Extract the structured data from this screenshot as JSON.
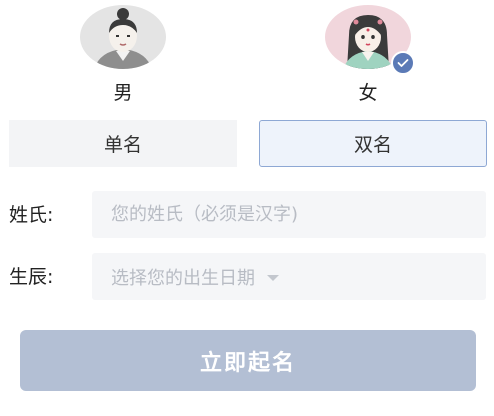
{
  "gender": {
    "male": {
      "label": "男",
      "icon": "male-avatar-icon"
    },
    "female": {
      "label": "女",
      "icon": "female-avatar-icon",
      "selected": true
    }
  },
  "name_type": {
    "single": "单名",
    "double": "双名",
    "selected": "double"
  },
  "form": {
    "surname_label": "姓氏:",
    "surname_placeholder": "您的姓氏（必须是汉字)",
    "birth_label": "生辰:",
    "birth_placeholder": "选择您的出生日期"
  },
  "submit_label": "立即起名",
  "colors": {
    "accent": "#5b7ab6",
    "selected_tab_border": "#8ea8d4",
    "button_bg": "#b3bfd4",
    "field_bg": "#f5f6f8"
  }
}
